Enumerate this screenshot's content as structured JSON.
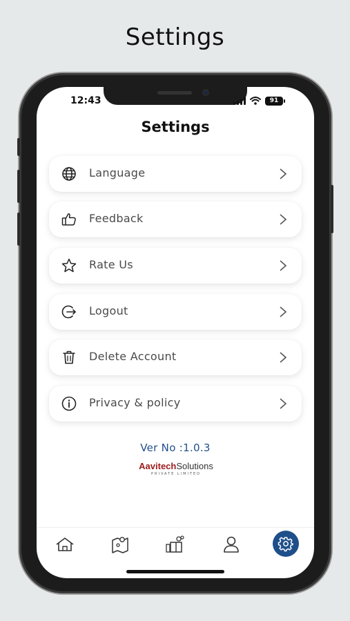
{
  "promo_title": "Settings",
  "status_bar": {
    "time": "12:43",
    "battery": "91"
  },
  "screen_title": "Settings",
  "menu": [
    {
      "label": "Language",
      "icon": "globe-icon"
    },
    {
      "label": "Feedback",
      "icon": "thumbs-up-icon"
    },
    {
      "label": "Rate Us",
      "icon": "star-icon"
    },
    {
      "label": "Logout",
      "icon": "logout-icon"
    },
    {
      "label": "Delete Account",
      "icon": "trash-icon"
    },
    {
      "label": "Privacy & policy",
      "icon": "info-icon"
    }
  ],
  "version": "Ver No :1.0.3",
  "brand": {
    "name_part1": "Aavitech",
    "name_part2": "Solutions",
    "subtitle": "PRIVATE LIMITED"
  },
  "tabs": [
    {
      "name": "home",
      "icon": "home-icon",
      "active": false
    },
    {
      "name": "map",
      "icon": "map-icon",
      "active": false
    },
    {
      "name": "gifts",
      "icon": "gift-icon",
      "active": false
    },
    {
      "name": "profile",
      "icon": "user-icon",
      "active": false
    },
    {
      "name": "settings",
      "icon": "gear-icon",
      "active": true
    }
  ],
  "colors": {
    "accent": "#1f4f8a",
    "brand_red": "#9b1b1b",
    "background": "#e6e9ea"
  }
}
